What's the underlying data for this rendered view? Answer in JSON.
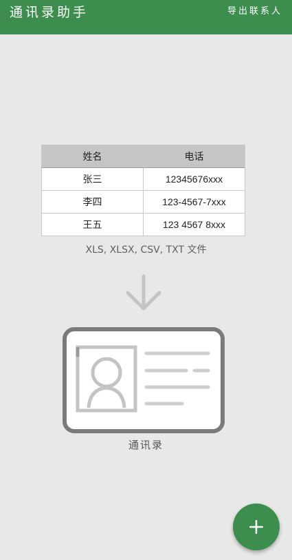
{
  "app_bar": {
    "title": "通讯录助手",
    "export_label": "导出联系人",
    "color": "#3d8d4f"
  },
  "sample_table": {
    "headers": [
      "姓名",
      "电话"
    ],
    "rows": [
      [
        "张三",
        "12345676xxx"
      ],
      [
        "李四",
        "123-4567-7xxx"
      ],
      [
        "王五",
        "123 4567 8xxx"
      ]
    ]
  },
  "formats_text": "XLS, XLSX, CSV, TXT 文件",
  "arrow_icon": "arrow-down-icon",
  "contact_card": {
    "icon": "contact-card-icon",
    "caption": "通讯录"
  },
  "fab": {
    "icon": "plus-icon",
    "color": "#3d8d4f"
  }
}
